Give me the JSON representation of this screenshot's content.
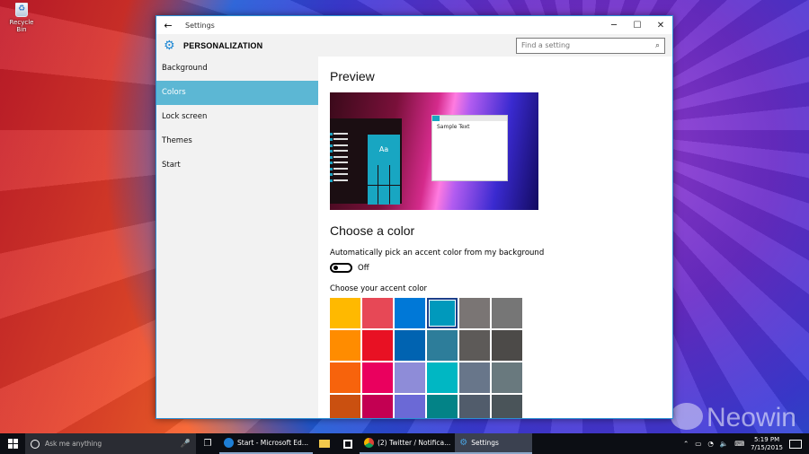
{
  "desktop": {
    "recycle_bin_label": "Recycle Bin",
    "watermark": "Neowin"
  },
  "window": {
    "title": "Settings",
    "back_icon": "←",
    "minimize_icon": "─",
    "maximize_icon": "☐",
    "close_icon": "✕",
    "section_title": "PERSONALIZATION",
    "gear_icon": "⚙",
    "search_placeholder": "Find a setting",
    "search_icon": "⌕"
  },
  "sidebar": {
    "items": [
      {
        "label": "Background"
      },
      {
        "label": "Colors",
        "active": true
      },
      {
        "label": "Lock screen"
      },
      {
        "label": "Themes"
      },
      {
        "label": "Start"
      }
    ]
  },
  "content": {
    "preview_title": "Preview",
    "preview_tile_text": "Aa",
    "preview_sample_text": "Sample Text",
    "choose_title": "Choose a color",
    "auto_label": "Automatically pick an accent color from my background",
    "toggle_state": "Off",
    "toggle_on": false,
    "accent_label": "Choose your accent color",
    "selected_swatch_index": 3,
    "swatches": [
      "#ffb900",
      "#e74856",
      "#0078d7",
      "#0099bc",
      "#7a7574",
      "#767676",
      "#ff8c00",
      "#e81123",
      "#0063b1",
      "#2d7d9a",
      "#5d5a58",
      "#4c4a48",
      "#f7630c",
      "#ea005e",
      "#8e8cd8",
      "#00b7c3",
      "#68768a",
      "#69797e",
      "#ca5010",
      "#c30052",
      "#6b69d6",
      "#038387",
      "#515c6b",
      "#4a5459"
    ]
  },
  "taskbar": {
    "search_placeholder": "Ask me anything",
    "mic_icon": "🎤",
    "task_view_icon": "❐",
    "apps": [
      {
        "name": "edge",
        "label": "Start - Microsoft Ed...",
        "color": "#1e7fd6"
      },
      {
        "name": "explorer",
        "label": "",
        "color": "#f2c94c"
      },
      {
        "name": "store",
        "label": "",
        "color": "#ffffff"
      },
      {
        "name": "chrome",
        "label": "(2) Twitter / Notifica...",
        "color": "#e0b020"
      },
      {
        "name": "settings",
        "label": "Settings",
        "color": "#4aa3e0",
        "active": true
      }
    ],
    "tray": {
      "chevron_icon": "⌃",
      "network_icon": "▭",
      "wifi_icon": "◔",
      "volume_icon": "🔈",
      "keyboard_icon": "⌨",
      "time": "5:19 PM",
      "date": "7/15/2015"
    }
  }
}
